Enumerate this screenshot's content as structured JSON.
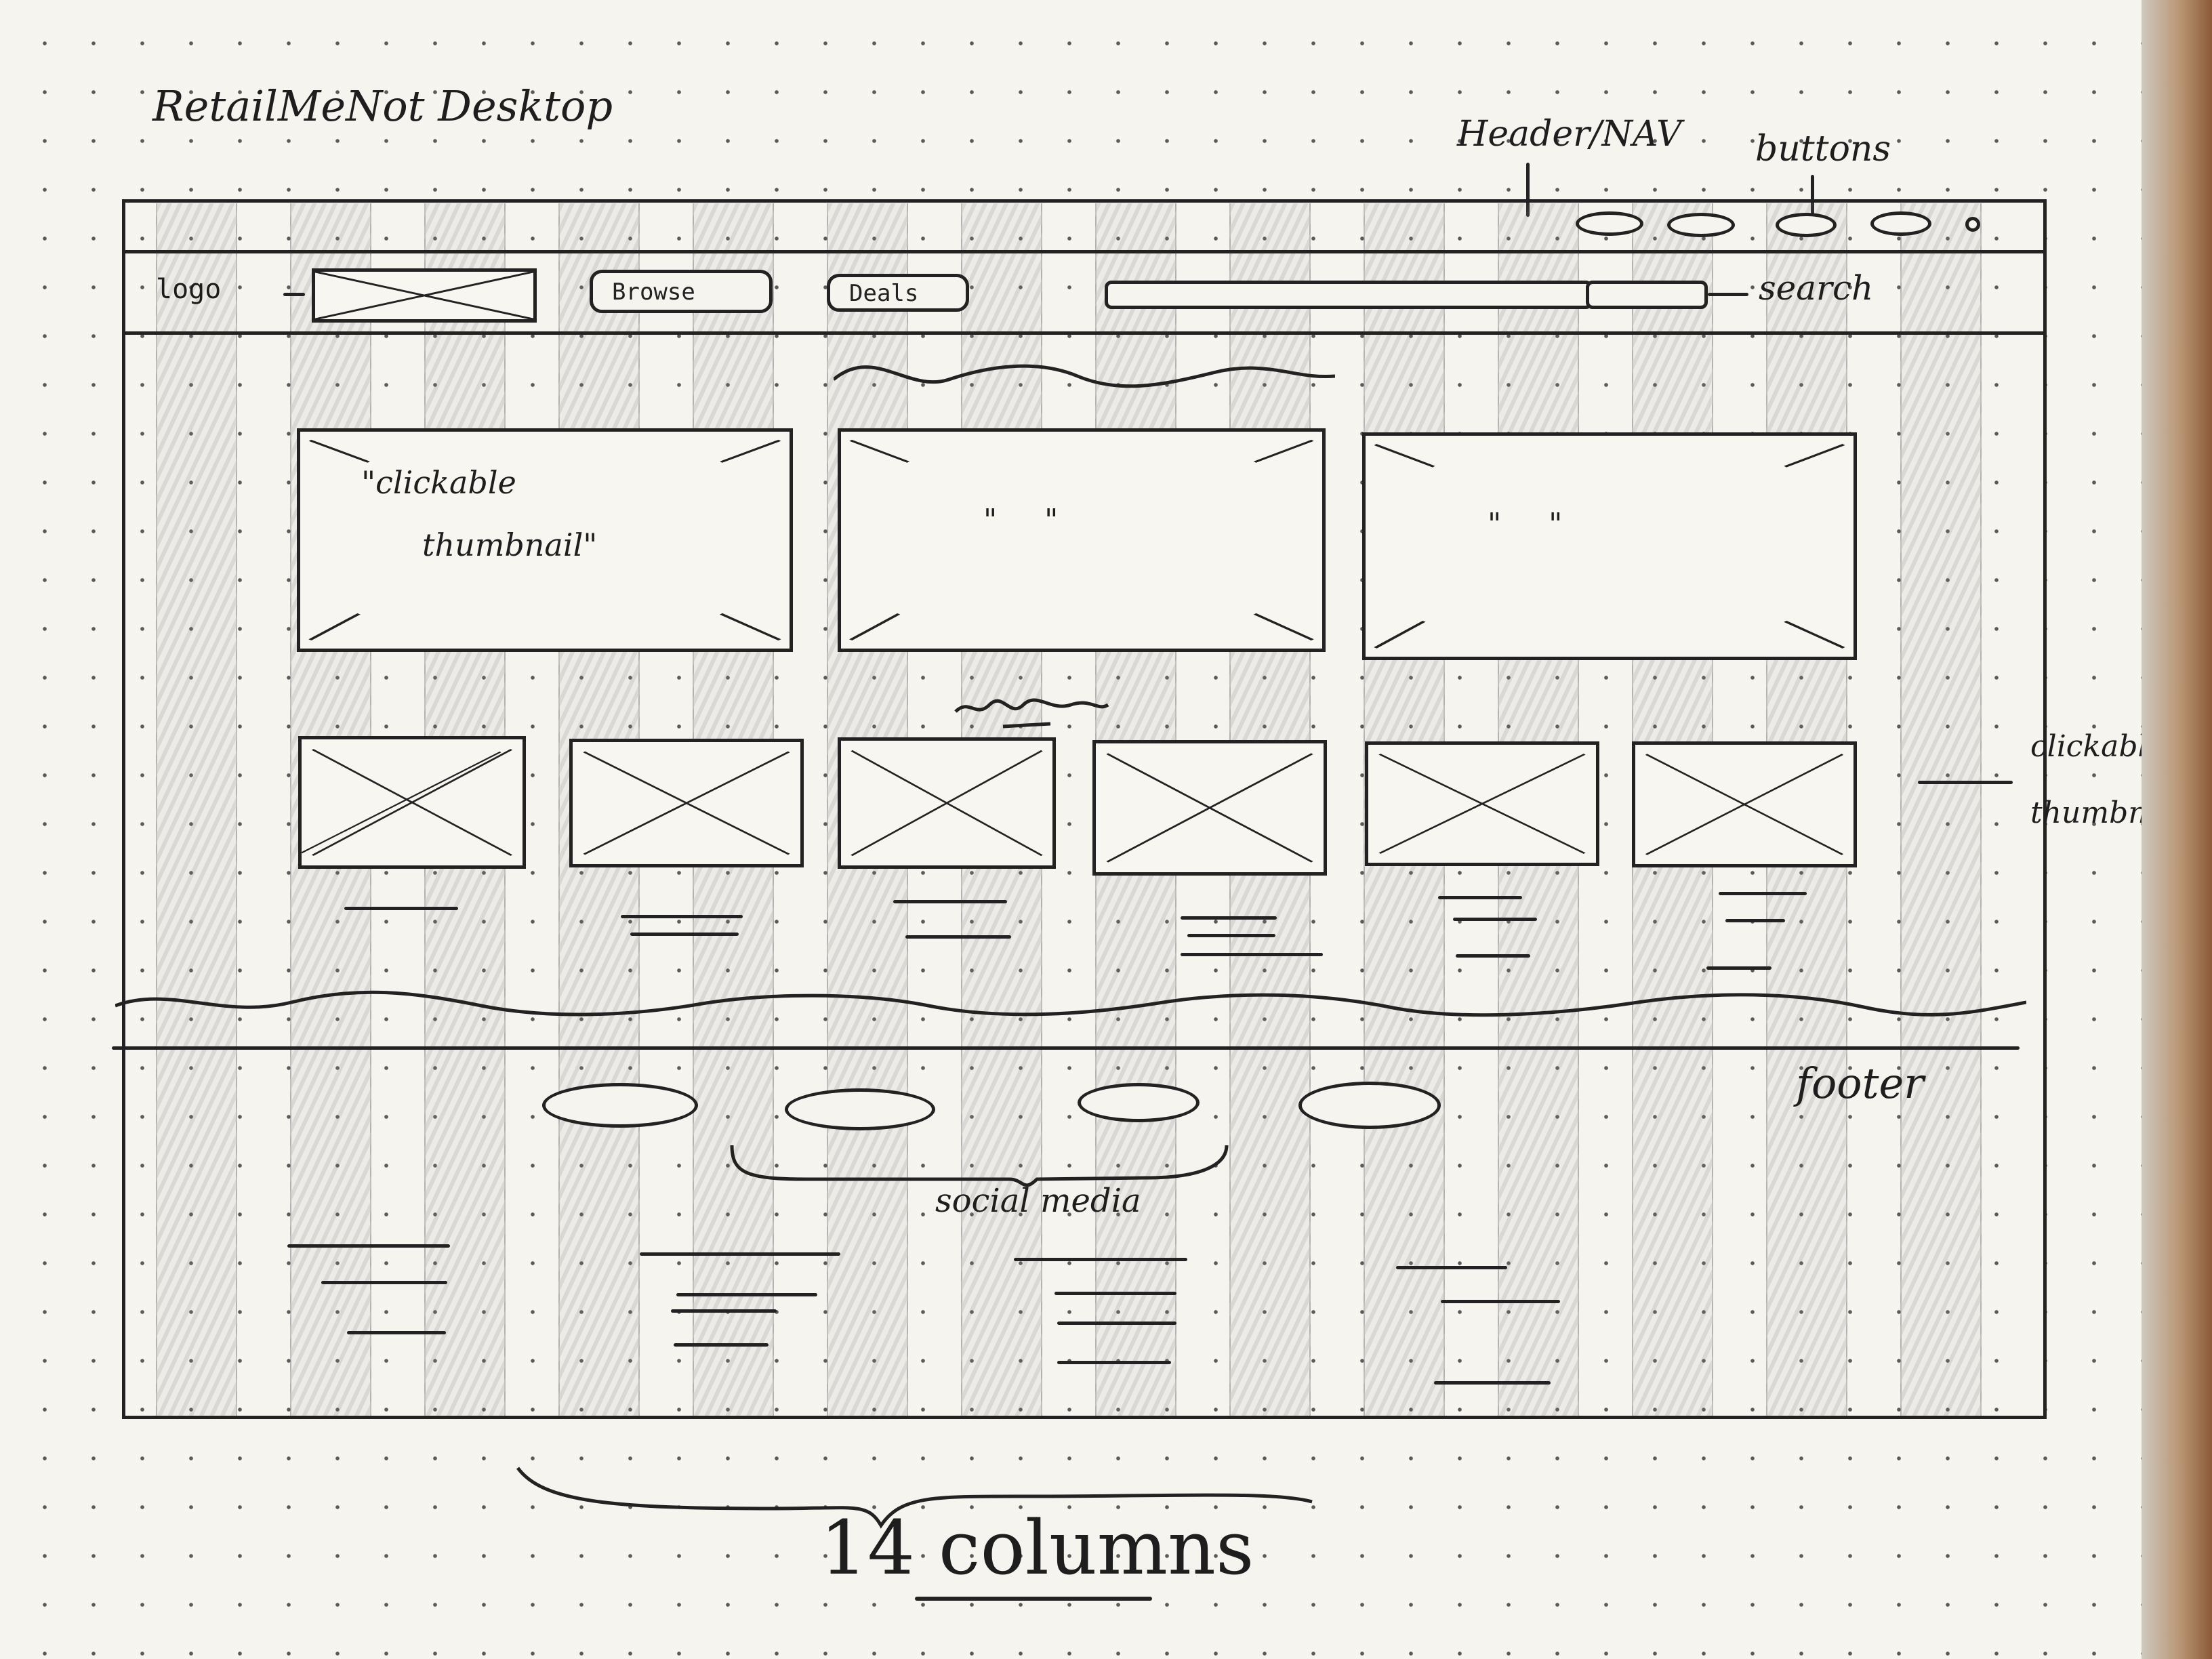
{
  "title": "RetailMeNot Desktop",
  "annotations": {
    "header_nav": "Header/NAV",
    "buttons": "buttons",
    "search": "search",
    "clickable_thumbnails": [
      "clickable",
      "thumbnails"
    ],
    "footer": "footer",
    "social_media": "social media",
    "columns": "14 columns"
  },
  "nav": {
    "logo": "logo",
    "browse_label": "Browse",
    "deals_label": "Deals"
  },
  "hero": {
    "thumbnail_caption_1": "\"clickable",
    "thumbnail_caption_2": "thumbnail\"",
    "ditto": "\"     \""
  }
}
